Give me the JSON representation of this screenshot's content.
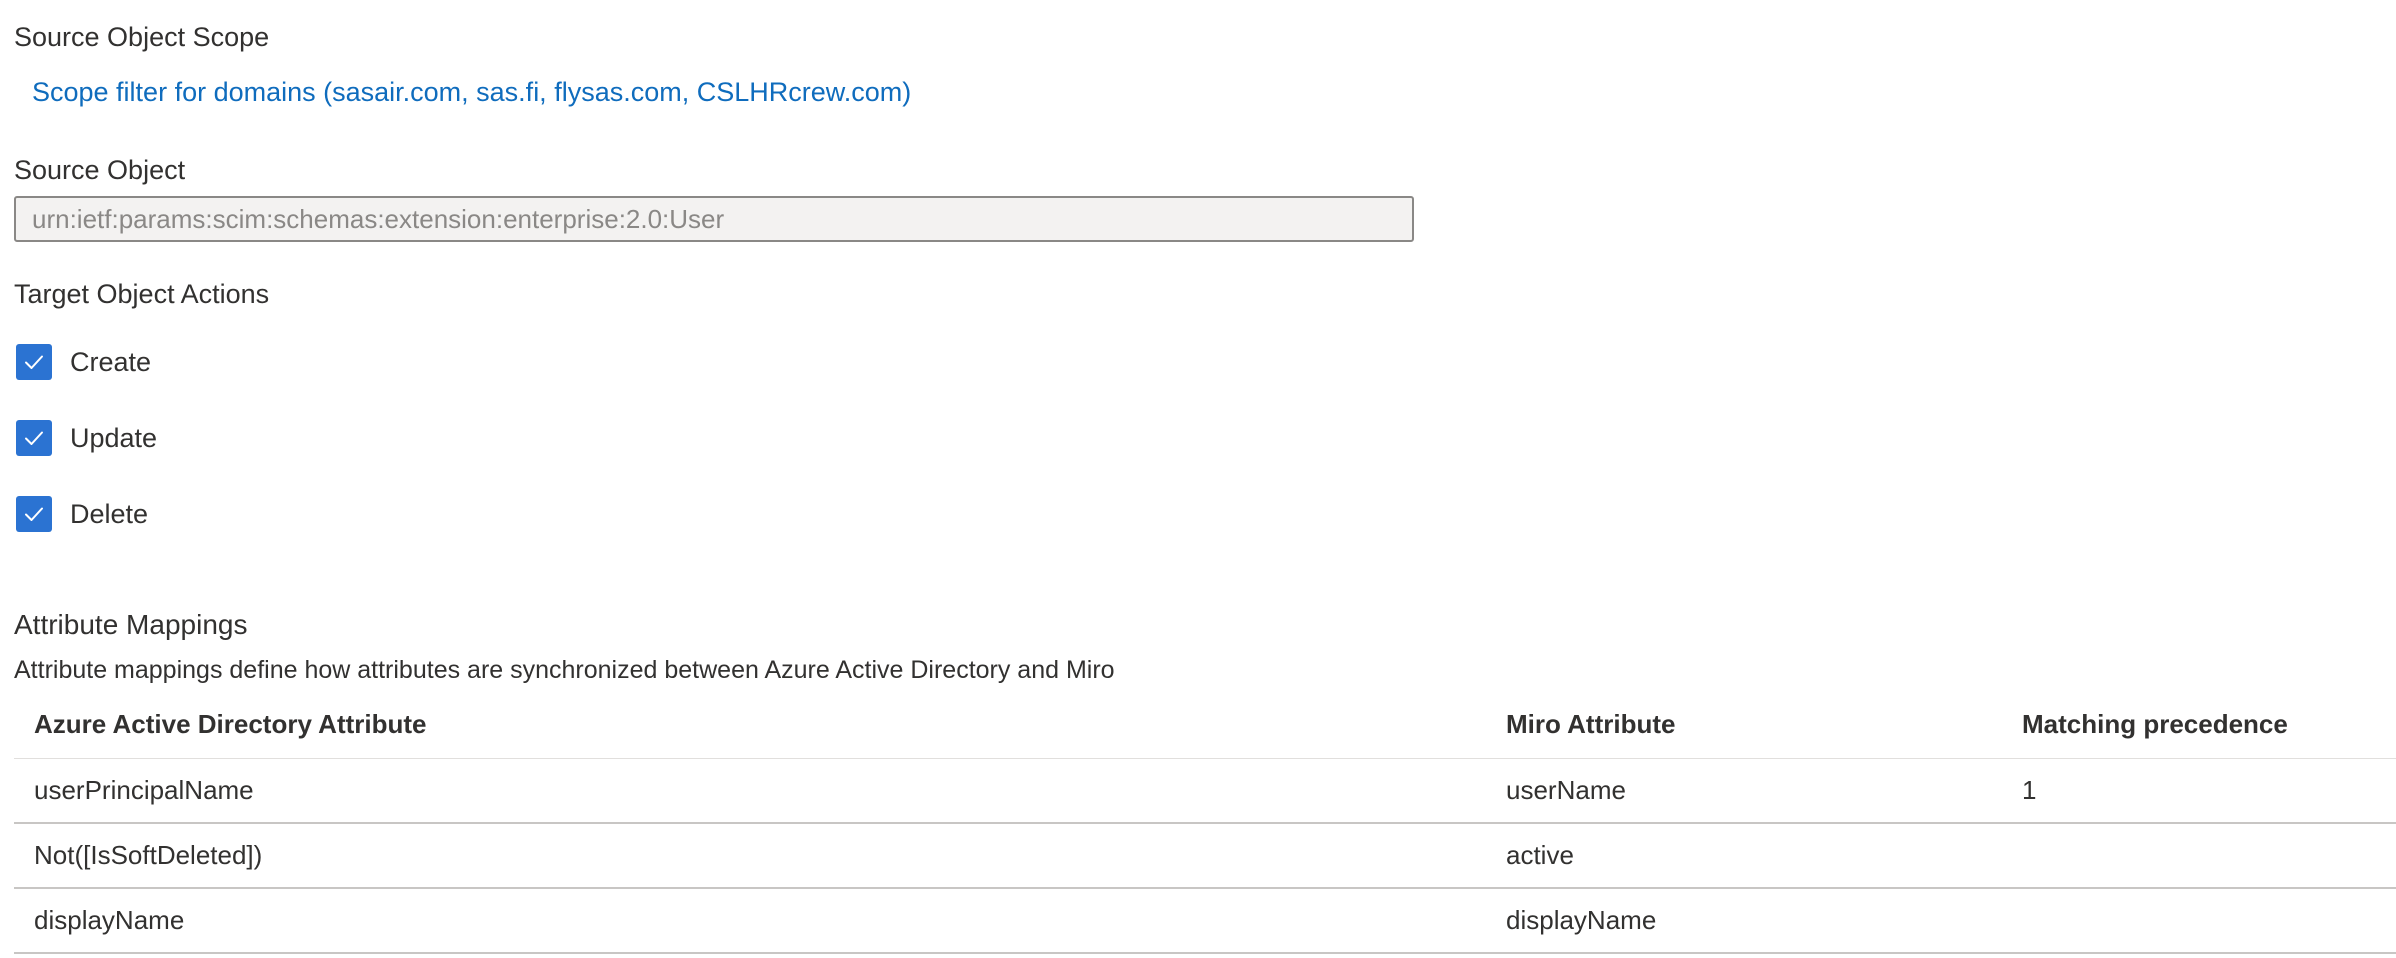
{
  "source_scope": {
    "label": "Source Object Scope",
    "link_text": "Scope filter for domains (sasair.com, sas.fi, flysas.com, CSLHRcrew.com)"
  },
  "source_object": {
    "label": "Source Object",
    "value": "urn:ietf:params:scim:schemas:extension:enterprise:2.0:User"
  },
  "target_actions": {
    "label": "Target Object Actions",
    "items": [
      {
        "label": "Create",
        "checked": true
      },
      {
        "label": "Update",
        "checked": true
      },
      {
        "label": "Delete",
        "checked": true
      }
    ]
  },
  "attribute_mappings": {
    "title": "Attribute Mappings",
    "description": "Attribute mappings define how attributes are synchronized between Azure Active Directory and Miro",
    "columns": [
      "Azure Active Directory Attribute",
      "Miro Attribute",
      "Matching precedence"
    ],
    "rows": [
      {
        "source": "userPrincipalName",
        "target": "userName",
        "precedence": "1"
      },
      {
        "source": "Not([IsSoftDeleted])",
        "target": "active",
        "precedence": ""
      },
      {
        "source": "displayName",
        "target": "displayName",
        "precedence": ""
      }
    ]
  },
  "colors": {
    "accent": "#2b73d2",
    "link": "#0f6cbd",
    "text": "#323130",
    "disabled_text": "#8a8886"
  }
}
